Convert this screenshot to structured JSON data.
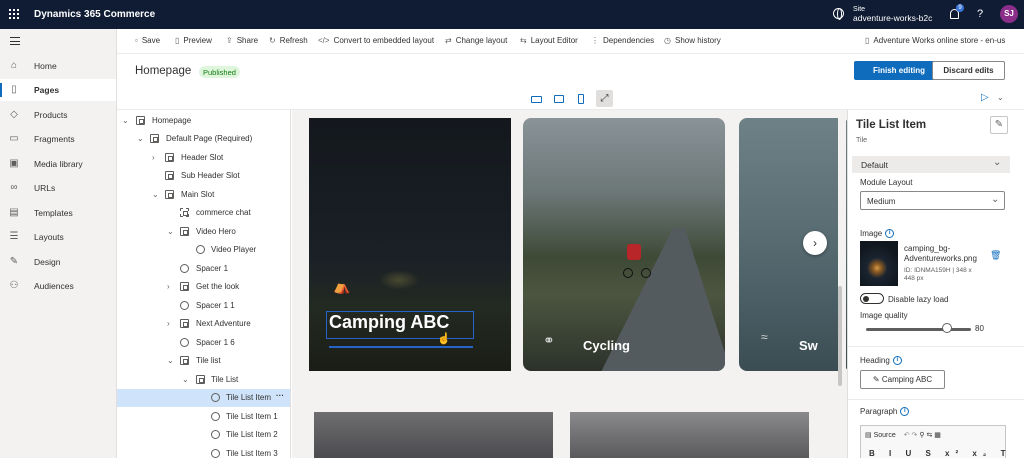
{
  "app": {
    "name": "Dynamics 365 Commerce"
  },
  "header": {
    "site_label": "Site",
    "site_value": "adventure-works-b2c",
    "notifications_count": "9",
    "help": "?",
    "avatar_initials": "SJ"
  },
  "left_nav": {
    "items": [
      {
        "label": "Home",
        "icon": "home-icon"
      },
      {
        "label": "Pages",
        "icon": "page-icon"
      },
      {
        "label": "Products",
        "icon": "products-icon"
      },
      {
        "label": "Fragments",
        "icon": "fragments-icon"
      },
      {
        "label": "Media library",
        "icon": "media-icon"
      },
      {
        "label": "URLs",
        "icon": "link-icon"
      },
      {
        "label": "Templates",
        "icon": "templates-icon"
      },
      {
        "label": "Layouts",
        "icon": "layouts-icon"
      },
      {
        "label": "Design",
        "icon": "design-icon"
      },
      {
        "label": "Audiences",
        "icon": "audiences-icon"
      }
    ],
    "active": "Pages"
  },
  "toolbar": {
    "save": "Save",
    "preview": "Preview",
    "share": "Share",
    "refresh": "Refresh",
    "convert": "Convert to embedded layout",
    "change_layout": "Change layout",
    "layout_editor": "Layout Editor",
    "dependencies": "Dependencies",
    "show_history": "Show history",
    "store": "Adventure Works online store - en-us"
  },
  "page": {
    "title": "Homepage",
    "status": "Published",
    "finish": "Finish editing",
    "discard": "Discard edits"
  },
  "tree": [
    "Homepage",
    "Default Page (Required)",
    "Header Slot",
    "Sub Header Slot",
    "Main Slot",
    "commerce chat",
    "Video Hero",
    "Video Player",
    "Spacer 1",
    "Get the look",
    "Spacer 1 1",
    "Next Adventure",
    "Spacer 1 6",
    "Tile list",
    "Tile List",
    "Tile List Item",
    "Tile List Item 1",
    "Tile List Item 2",
    "Tile List Item 3"
  ],
  "tree_more": "···",
  "canvas": {
    "tiles": [
      "Camping ABC",
      "Cycling",
      "Sw"
    ],
    "next": "›"
  },
  "props": {
    "title": "Tile List Item",
    "subtitle": "Tile",
    "section": "Default",
    "module_layout_label": "Module Layout",
    "module_layout_value": "Medium",
    "image_label": "Image",
    "image_name": "camping_bg-Adventureworks.png",
    "image_meta": "ID: IDNMA159H | 348 x 448 px",
    "lazy_label": "Disable lazy load",
    "quality_label": "Image quality",
    "quality_value": "80",
    "heading_label": "Heading",
    "heading_value": "Camping ABC",
    "paragraph_label": "Paragraph",
    "rte_source": "Source",
    "rte_format": "B I U S x² x₂ T"
  },
  "colors": {
    "accent": "#0f6cbd",
    "topbar": "#0f1c34",
    "published": "#107c10"
  }
}
